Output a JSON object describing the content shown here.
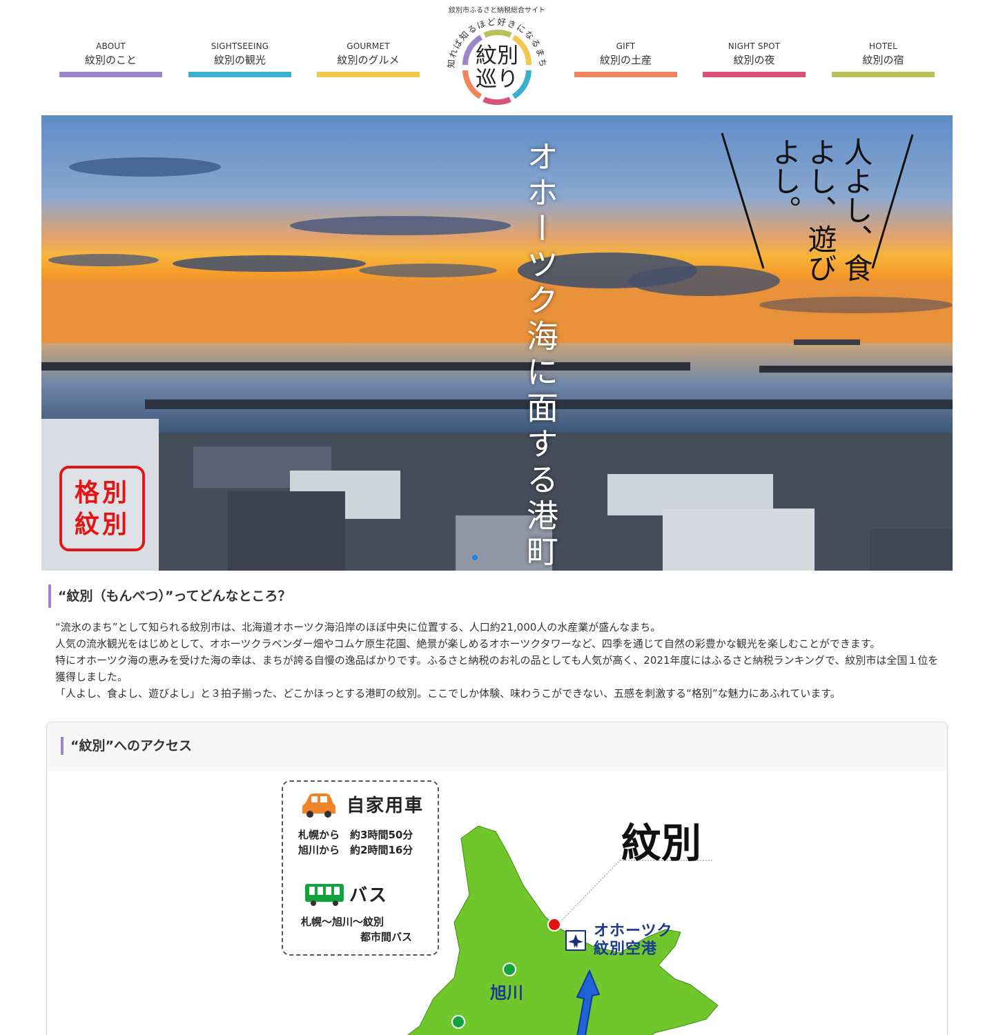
{
  "header": {
    "tagline": "紋別市ふるさと納税総合サイト",
    "nav": [
      {
        "en": "ABOUT",
        "ja": "紋別のこと",
        "color": "#9b86c9"
      },
      {
        "en": "SIGHTSEEING",
        "ja": "紋別の観光",
        "color": "#3ab0d0"
      },
      {
        "en": "GOURMET",
        "ja": "紋別のグルメ",
        "color": "#f2c94c"
      },
      {
        "en": "GIFT",
        "ja": "紋別の土産",
        "color": "#f0845a"
      },
      {
        "en": "NIGHT SPOT",
        "ja": "紋別の夜",
        "color": "#d9527a"
      },
      {
        "en": "HOTEL",
        "ja": "紋別の宿",
        "color": "#b9c25a"
      }
    ],
    "logo": {
      "arc_text": "知れば知るほど好きになるまち",
      "title_line1": "紋別",
      "title_line2": "巡り"
    }
  },
  "hero": {
    "vertical_title": "オホーツク海に面する港町",
    "slogan": "人よし、食よし、遊びよし。",
    "stamp_line1": "格別",
    "stamp_line2": "紋別"
  },
  "about": {
    "heading": "“紋別（もんべつ）”ってどんなところ？",
    "paragraphs": [
      "“流氷のまち”として知られる紋別市は、北海道オホーツク海沿岸のほぼ中央に位置する、人口約21,000人の水産業が盛んなまち。",
      "人気の流氷観光をはじめとして、オホーツクラベンダー畑やコムケ原生花園、絶景が楽しめるオホーツクタワーなど、四季を通じて自然の彩豊かな観光を楽しむことができます。",
      "特にオホーツク海の恵みを受けた海の幸は、まちが誇る自慢の逸品ばかりです。ふるさと納税のお礼の品としても人気が高く、2021年度にはふるさと納税ランキングで、紋別市は全国１位を獲得しました。",
      "「人よし、食よし、遊びよし」と３拍子揃った、どこかほっとする港町の紋別。ここでしか体験、味わうこができない、五感を刺激する“格別”な魅力にあふれています。"
    ]
  },
  "access": {
    "heading": "“紋別”へのアクセス",
    "car": {
      "title": "自家用車",
      "lines": [
        "札幌から　約3時間50分",
        "旭川から　約2時間16分"
      ]
    },
    "bus": {
      "title": "バス",
      "line1": "札幌〜旭川〜紋別",
      "line2": "都市間バス"
    },
    "map": {
      "city_label": "紋別",
      "airport_line1": "オホーツク",
      "airport_line2": "紋別空港",
      "asahikawa": "旭川"
    }
  }
}
